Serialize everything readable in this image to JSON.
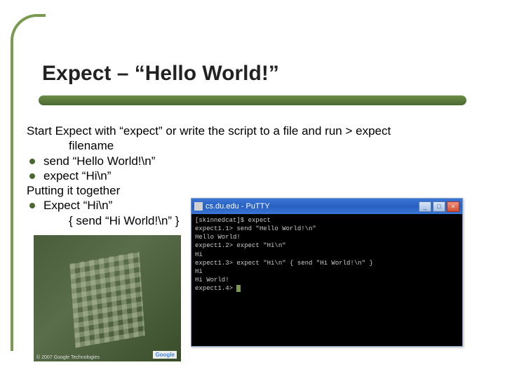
{
  "title": "Expect – “Hello World!”",
  "intro_line1": "Start Expect with “expect” or write the script to a file and run > expect",
  "intro_line2": "filename",
  "bullets": {
    "b1": "send “Hello World!\\n”",
    "b2": "expect “Hi\\n”"
  },
  "putting": "Putting it together",
  "bullet3": "Expect “Hi\\n”",
  "bullet3_sub": "{ send “Hi World!\\n” }",
  "left_image": {
    "attribution": "Google",
    "copyright": "© 2007 Google Technologies"
  },
  "putty": {
    "title": "cs.du.edu - PuTTY",
    "lines": [
      "[skinnedcat]$ expect",
      "expect1.1> send \"Hello World!\\n\"",
      "Hello World!",
      "expect1.2> expect \"Hi\\n\"",
      "Hi",
      "expect1.3> expect \"Hi\\n\" { send \"Hi World!\\n\" }",
      "Hi",
      "Hi World!",
      "expect1.4>"
    ],
    "btn_min": "_",
    "btn_max": "□",
    "btn_close": "×"
  }
}
